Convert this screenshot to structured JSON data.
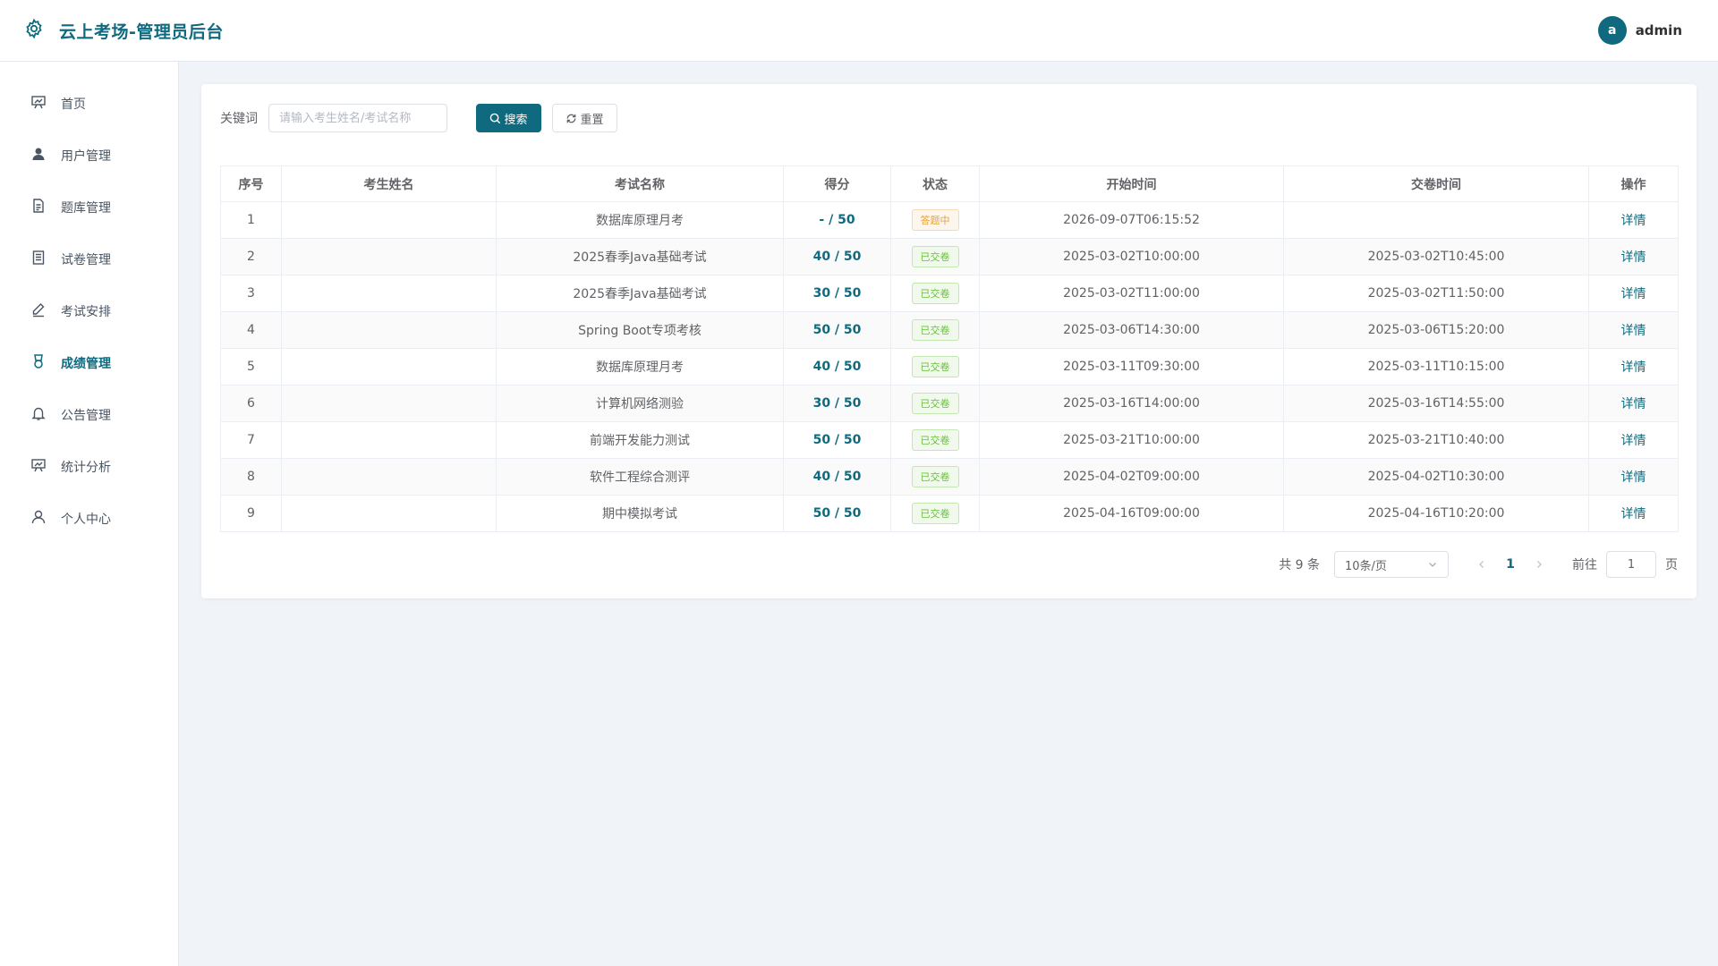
{
  "header": {
    "title": "云上考场-管理员后台",
    "user": {
      "avatar_letter": "a",
      "name": "admin"
    }
  },
  "sidebar": {
    "items": [
      {
        "label": "首页",
        "icon": "dashboard-icon"
      },
      {
        "label": "用户管理",
        "icon": "user-icon"
      },
      {
        "label": "题库管理",
        "icon": "document-icon"
      },
      {
        "label": "试卷管理",
        "icon": "tickets-icon"
      },
      {
        "label": "考试安排",
        "icon": "edit-pen-icon"
      },
      {
        "label": "成绩管理",
        "icon": "medal-icon",
        "active": true
      },
      {
        "label": "公告管理",
        "icon": "bell-icon"
      },
      {
        "label": "统计分析",
        "icon": "chart-board-icon"
      },
      {
        "label": "个人中心",
        "icon": "user-outline-icon"
      }
    ]
  },
  "search": {
    "label": "关键词",
    "placeholder": "请输入考生姓名/考试名称",
    "value": "",
    "search_button": "搜索",
    "reset_button": "重置"
  },
  "table": {
    "headers": [
      "序号",
      "考生姓名",
      "考试名称",
      "得分",
      "状态",
      "开始时间",
      "交卷时间",
      "操作"
    ],
    "rows": [
      {
        "index": "1",
        "student": "",
        "exam": "数据库原理月考",
        "score": "- / 50",
        "status": "答题中",
        "status_type": "doing",
        "start": "2026-09-07T06:15:52",
        "submit": "",
        "action": "详情"
      },
      {
        "index": "2",
        "student": "",
        "exam": "2025春季Java基础考试",
        "score": "40 / 50",
        "status": "已交卷",
        "status_type": "done",
        "start": "2025-03-02T10:00:00",
        "submit": "2025-03-02T10:45:00",
        "action": "详情"
      },
      {
        "index": "3",
        "student": "",
        "exam": "2025春季Java基础考试",
        "score": "30 / 50",
        "status": "已交卷",
        "status_type": "done",
        "start": "2025-03-02T11:00:00",
        "submit": "2025-03-02T11:50:00",
        "action": "详情"
      },
      {
        "index": "4",
        "student": "",
        "exam": "Spring Boot专项考核",
        "score": "50 / 50",
        "status": "已交卷",
        "status_type": "done",
        "start": "2025-03-06T14:30:00",
        "submit": "2025-03-06T15:20:00",
        "action": "详情"
      },
      {
        "index": "5",
        "student": "",
        "exam": "数据库原理月考",
        "score": "40 / 50",
        "status": "已交卷",
        "status_type": "done",
        "start": "2025-03-11T09:30:00",
        "submit": "2025-03-11T10:15:00",
        "action": "详情"
      },
      {
        "index": "6",
        "student": "",
        "exam": "计算机网络测验",
        "score": "30 / 50",
        "status": "已交卷",
        "status_type": "done",
        "start": "2025-03-16T14:00:00",
        "submit": "2025-03-16T14:55:00",
        "action": "详情"
      },
      {
        "index": "7",
        "student": "",
        "exam": "前端开发能力测试",
        "score": "50 / 50",
        "status": "已交卷",
        "status_type": "done",
        "start": "2025-03-21T10:00:00",
        "submit": "2025-03-21T10:40:00",
        "action": "详情"
      },
      {
        "index": "8",
        "student": "",
        "exam": "软件工程综合测评",
        "score": "40 / 50",
        "status": "已交卷",
        "status_type": "done",
        "start": "2025-04-02T09:00:00",
        "submit": "2025-04-02T10:30:00",
        "action": "详情"
      },
      {
        "index": "9",
        "student": "",
        "exam": "期中模拟考试",
        "score": "50 / 50",
        "status": "已交卷",
        "status_type": "done",
        "start": "2025-04-16T09:00:00",
        "submit": "2025-04-16T10:20:00",
        "action": "详情"
      }
    ]
  },
  "pagination": {
    "total_text": "共 9 条",
    "page_size": "10条/页",
    "current_page": "1",
    "goto_label": "前往",
    "goto_value": "1",
    "goto_suffix": "页"
  },
  "colors": {
    "primary": "#0f6a7f",
    "success": "#67c23a",
    "warning": "#e6a23c",
    "background": "#f0f3f7"
  }
}
